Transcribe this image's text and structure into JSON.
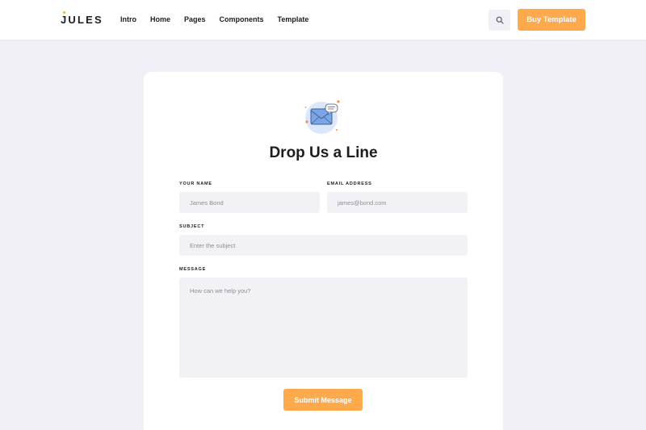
{
  "header": {
    "logo": "JULES",
    "nav": [
      "Intro",
      "Home",
      "Pages",
      "Components",
      "Template"
    ],
    "search_icon": "search-icon",
    "buy_label": "Buy Template"
  },
  "form": {
    "icon": "envelope-chat-icon",
    "title": "Drop Us a Line",
    "name_label": "YOUR NAME",
    "name_placeholder": "James Bond",
    "email_label": "EMAIL ADDRESS",
    "email_placeholder": "james@bond.com",
    "subject_label": "SUBJECT",
    "subject_placeholder": "Enter the subject",
    "message_label": "MESSAGE",
    "message_placeholder": "How can we help you?",
    "submit_label": "Submit Message"
  },
  "colors": {
    "accent": "#ffa94d",
    "background": "#f0f0f6",
    "field": "#f1f1f6"
  }
}
